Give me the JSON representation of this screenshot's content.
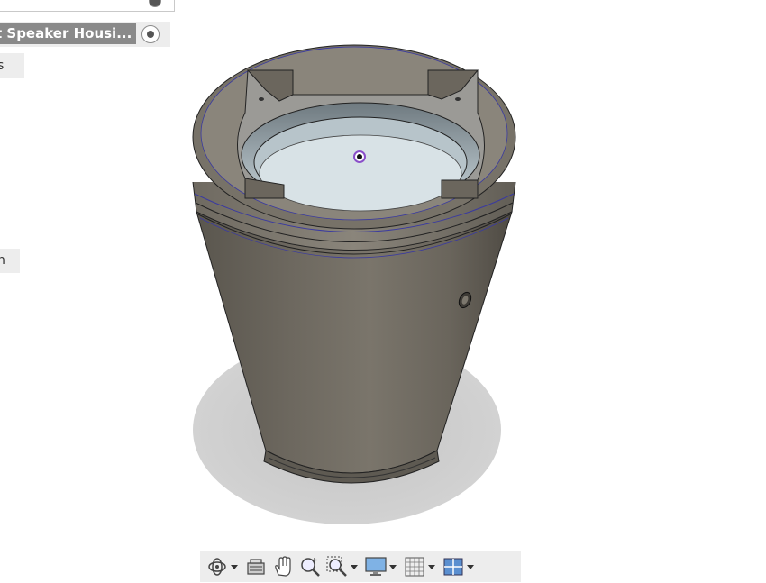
{
  "browser": {
    "document_label": "t Speaker Housi...",
    "tab_a_text": "s",
    "tab_b_text": "n"
  },
  "toolbar": {
    "icons": [
      "orbit-icon",
      "look-at-icon",
      "pan-icon",
      "zoom-icon",
      "zoom-window-icon",
      "display-settings-icon",
      "grid-icon",
      "viewports-icon"
    ]
  },
  "colors": {
    "panel_bg": "#ededed",
    "document_label_bg": "#8a8a8a",
    "model_body": "#6a655c",
    "shadow": "#cfcfcf"
  }
}
